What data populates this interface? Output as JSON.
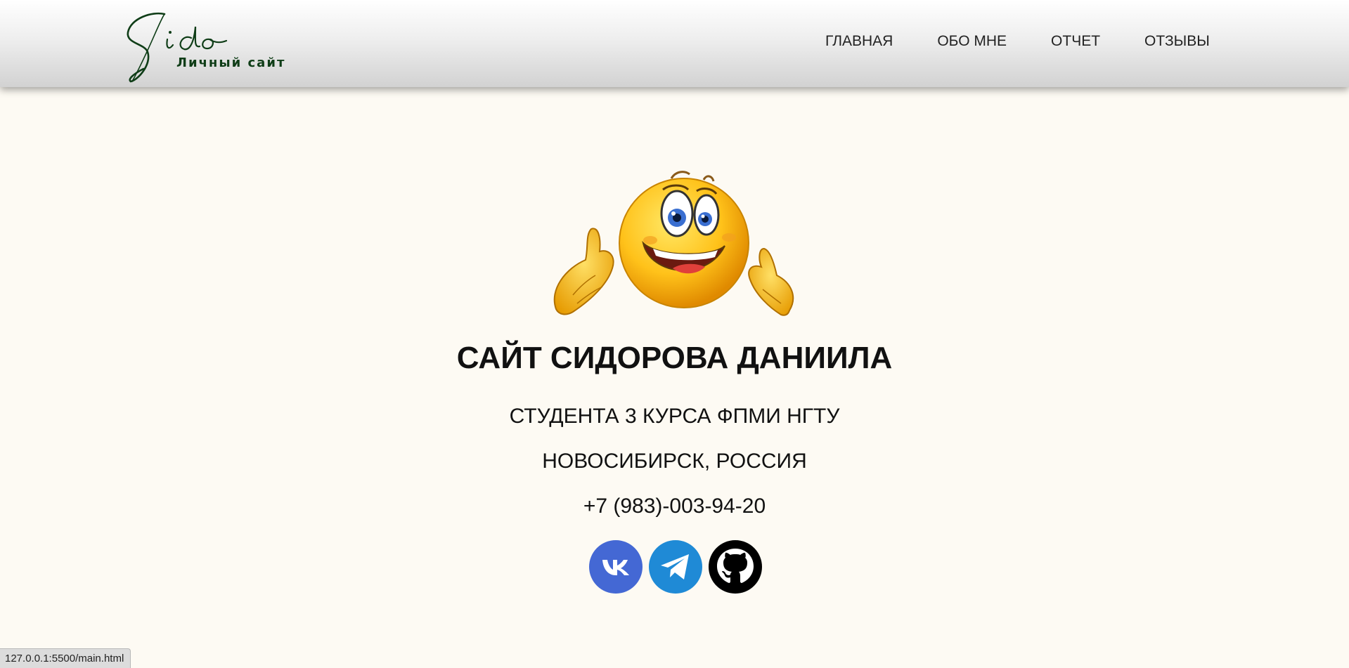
{
  "header": {
    "logo": {
      "script_text": "Sido",
      "subtitle": "Личный сайт",
      "color": "#0f3d17"
    },
    "nav": [
      {
        "label": "ГЛАВНАЯ"
      },
      {
        "label": "ОБО МНЕ"
      },
      {
        "label": "ОТЧЕТ"
      },
      {
        "label": "ОТЗЫВЫ"
      }
    ]
  },
  "hero": {
    "emoji_icon": "smiley-welcome-hands-icon",
    "title": "САЙТ СИДОРОВА ДАНИИЛА",
    "subtitle": "СТУДЕНТА 3 КУРСА ФПМИ НГТУ",
    "location": "НОВОСИБИРСК, РОССИЯ",
    "phone": "+7 (983)-003-94-20"
  },
  "socials": [
    {
      "icon": "vk-icon",
      "color": "#4468d4"
    },
    {
      "icon": "telegram-icon",
      "color": "#1f8ad6"
    },
    {
      "icon": "github-icon",
      "color": "#000000"
    }
  ],
  "status_bar": {
    "url": "127.0.0.1:5500/main.html"
  },
  "colors": {
    "background": "#fdfaf3",
    "text": "#111111"
  }
}
